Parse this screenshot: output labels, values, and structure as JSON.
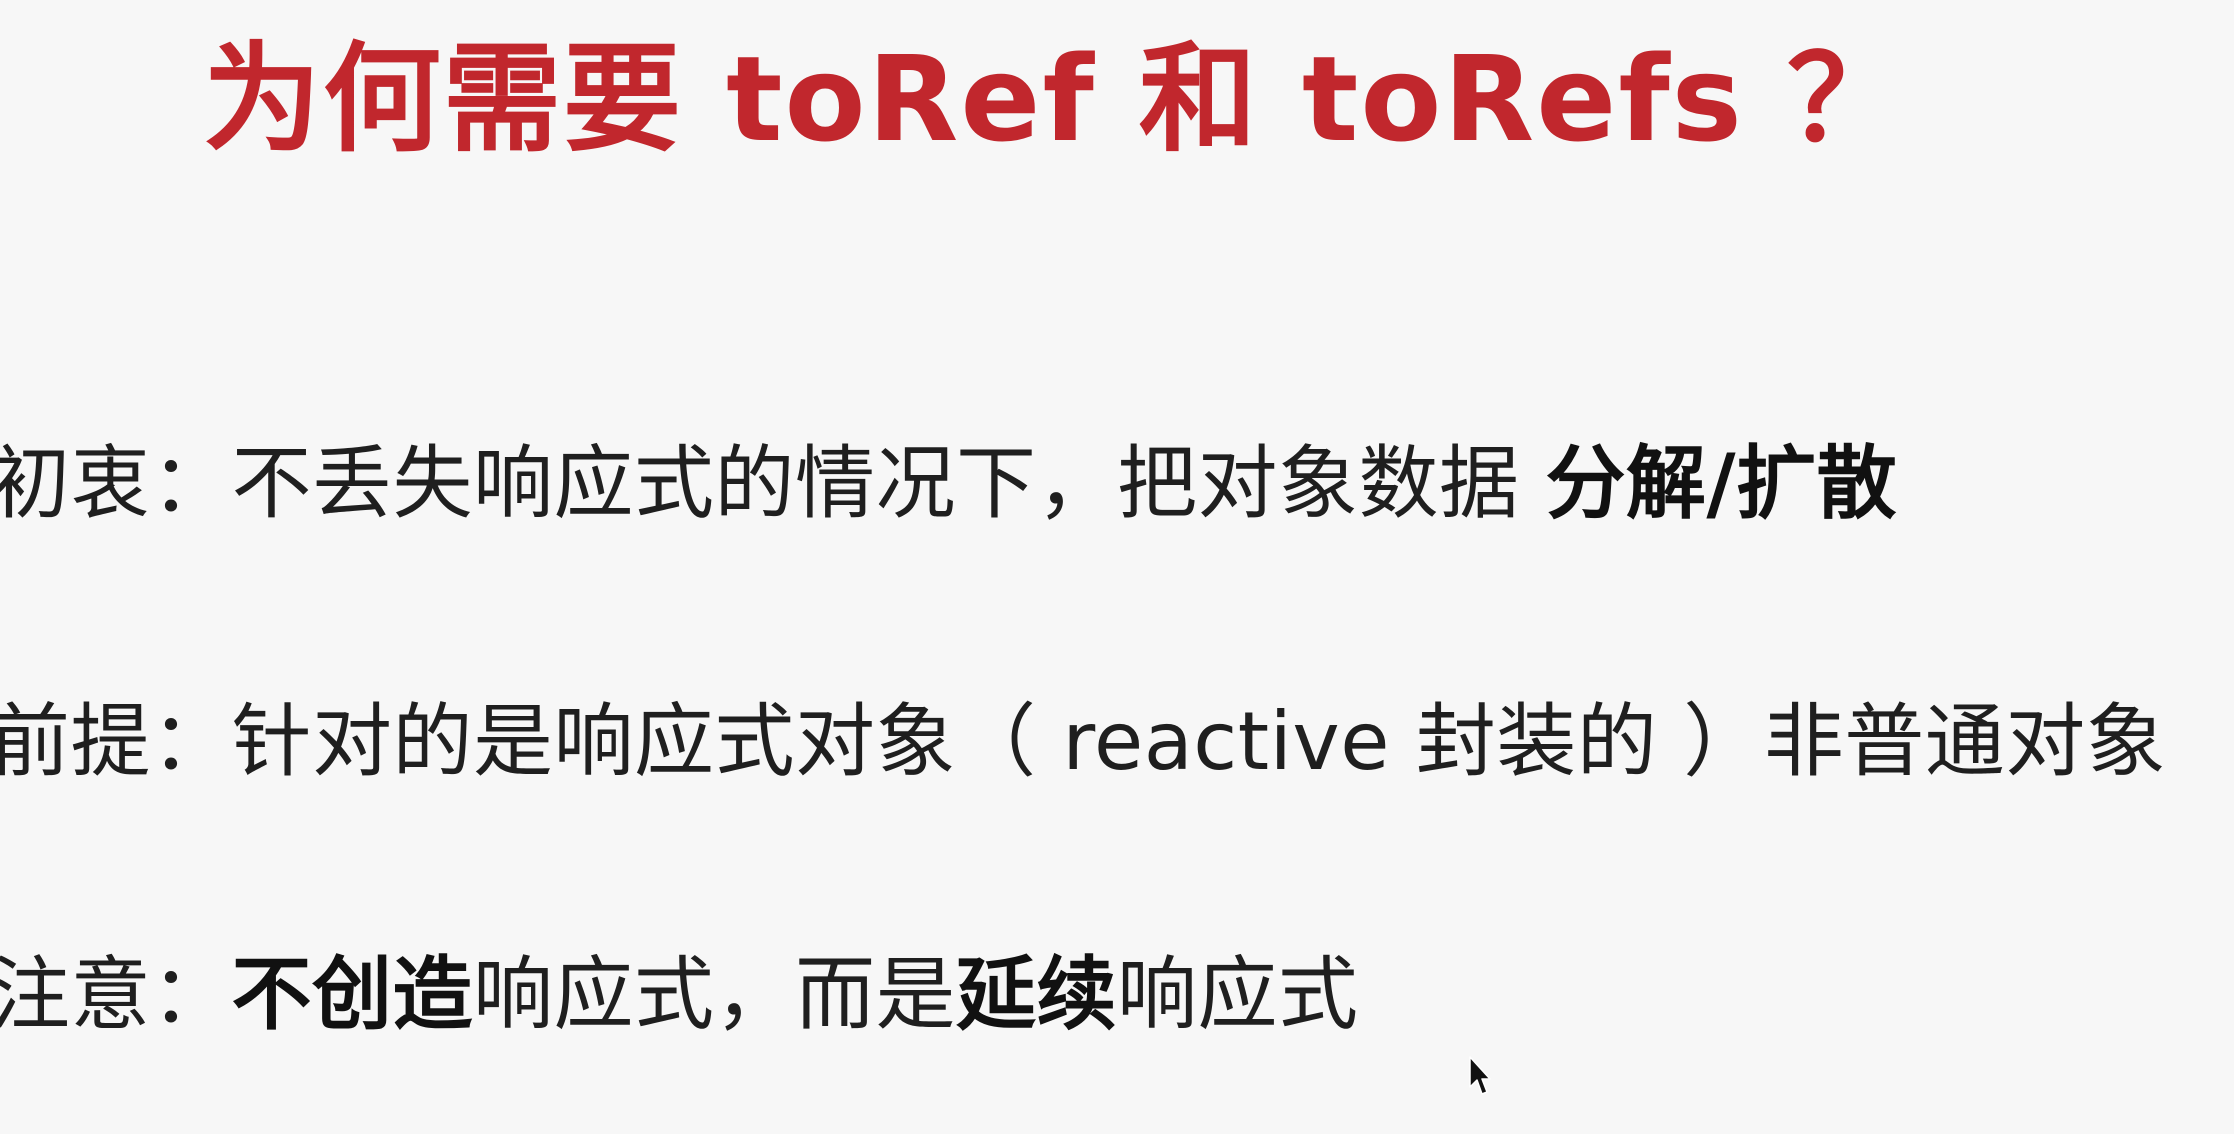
{
  "slide": {
    "title": "为何需要 toRef 和 toRefs ？",
    "lines": [
      {
        "prefix": "初衷：",
        "text": "不丢失响应式的情况下，把对象数据 ",
        "emphasis": "分解/扩散"
      },
      {
        "prefix": "前提：",
        "text": "针对的是响应式对象（ reactive 封装的 ）非普通对象"
      },
      {
        "prefix": "注意：",
        "emphasis_1": "不创造",
        "text_1": "响应式，而是",
        "emphasis_2": "延续",
        "text_2": "响应式"
      }
    ]
  },
  "colors": {
    "title": "#c1272d",
    "text": "#1f1f1f",
    "background": "#f7f7f7"
  },
  "icons": {
    "cursor": "mouse-pointer-icon"
  }
}
